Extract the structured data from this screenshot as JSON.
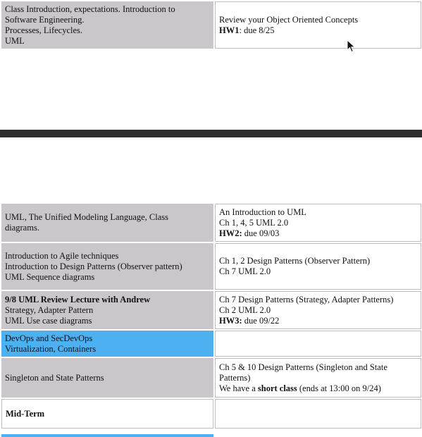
{
  "top": {
    "left_lines": [
      "Class Introduction, expectations. Introduction to",
      "Software Engineering.",
      "Processes, Lifecycles.",
      "UML"
    ],
    "right_line1": "Review your Object Oriented Concepts",
    "right_hw_label": "HW1",
    "right_hw_rest": ": due 8/25"
  },
  "rows": [
    {
      "left": [
        "UML, The Unified Modeling Language, Class",
        "diagrams."
      ],
      "right1": "An Introduction to UML",
      "right2": "Ch 1, 4, 5 UML 2.0",
      "hw_label": "HW2:",
      "hw_rest": " due 09/03"
    },
    {
      "left": [
        "Introduction to Agile techniques",
        "Introduction to Design Patterns (Observer pattern)",
        "UML Sequence diagrams"
      ],
      "right1": "Ch 1,  2 Design Patterns (Observer Pattern)",
      "right2": "Ch 7 UML 2.0"
    },
    {
      "left_bold": "9/8 UML Review Lecture with Andrew",
      "left": [
        "Strategy, Adapter Pattern",
        "UML Use case diagrams"
      ],
      "right1": "Ch 7 Design Patterns (Strategy, Adapter Patterns)",
      "right2": "Ch 2 UML 2.0",
      "hw_label": "HW3:",
      "hw_rest": " due 09/22"
    },
    {
      "left": [
        "DevOps and SecDevOps",
        "Virtualization, Containers"
      ],
      "highlight_color": "#4db0f0"
    },
    {
      "left": [
        "Singleton and State Patterns"
      ],
      "right1": "Ch 5 & 10 Design Patterns (Singleton and State Patterns)",
      "right2_pre": "We have a ",
      "right2_bold": "short class",
      "right2_post": " (ends at 13:00 on 9/24)"
    },
    {
      "left_bold": "Mid-Term"
    }
  ],
  "colors": {
    "left_cell": "#c9c7cb",
    "highlight": "#4db0f0",
    "divider": "#2e2e2e"
  }
}
